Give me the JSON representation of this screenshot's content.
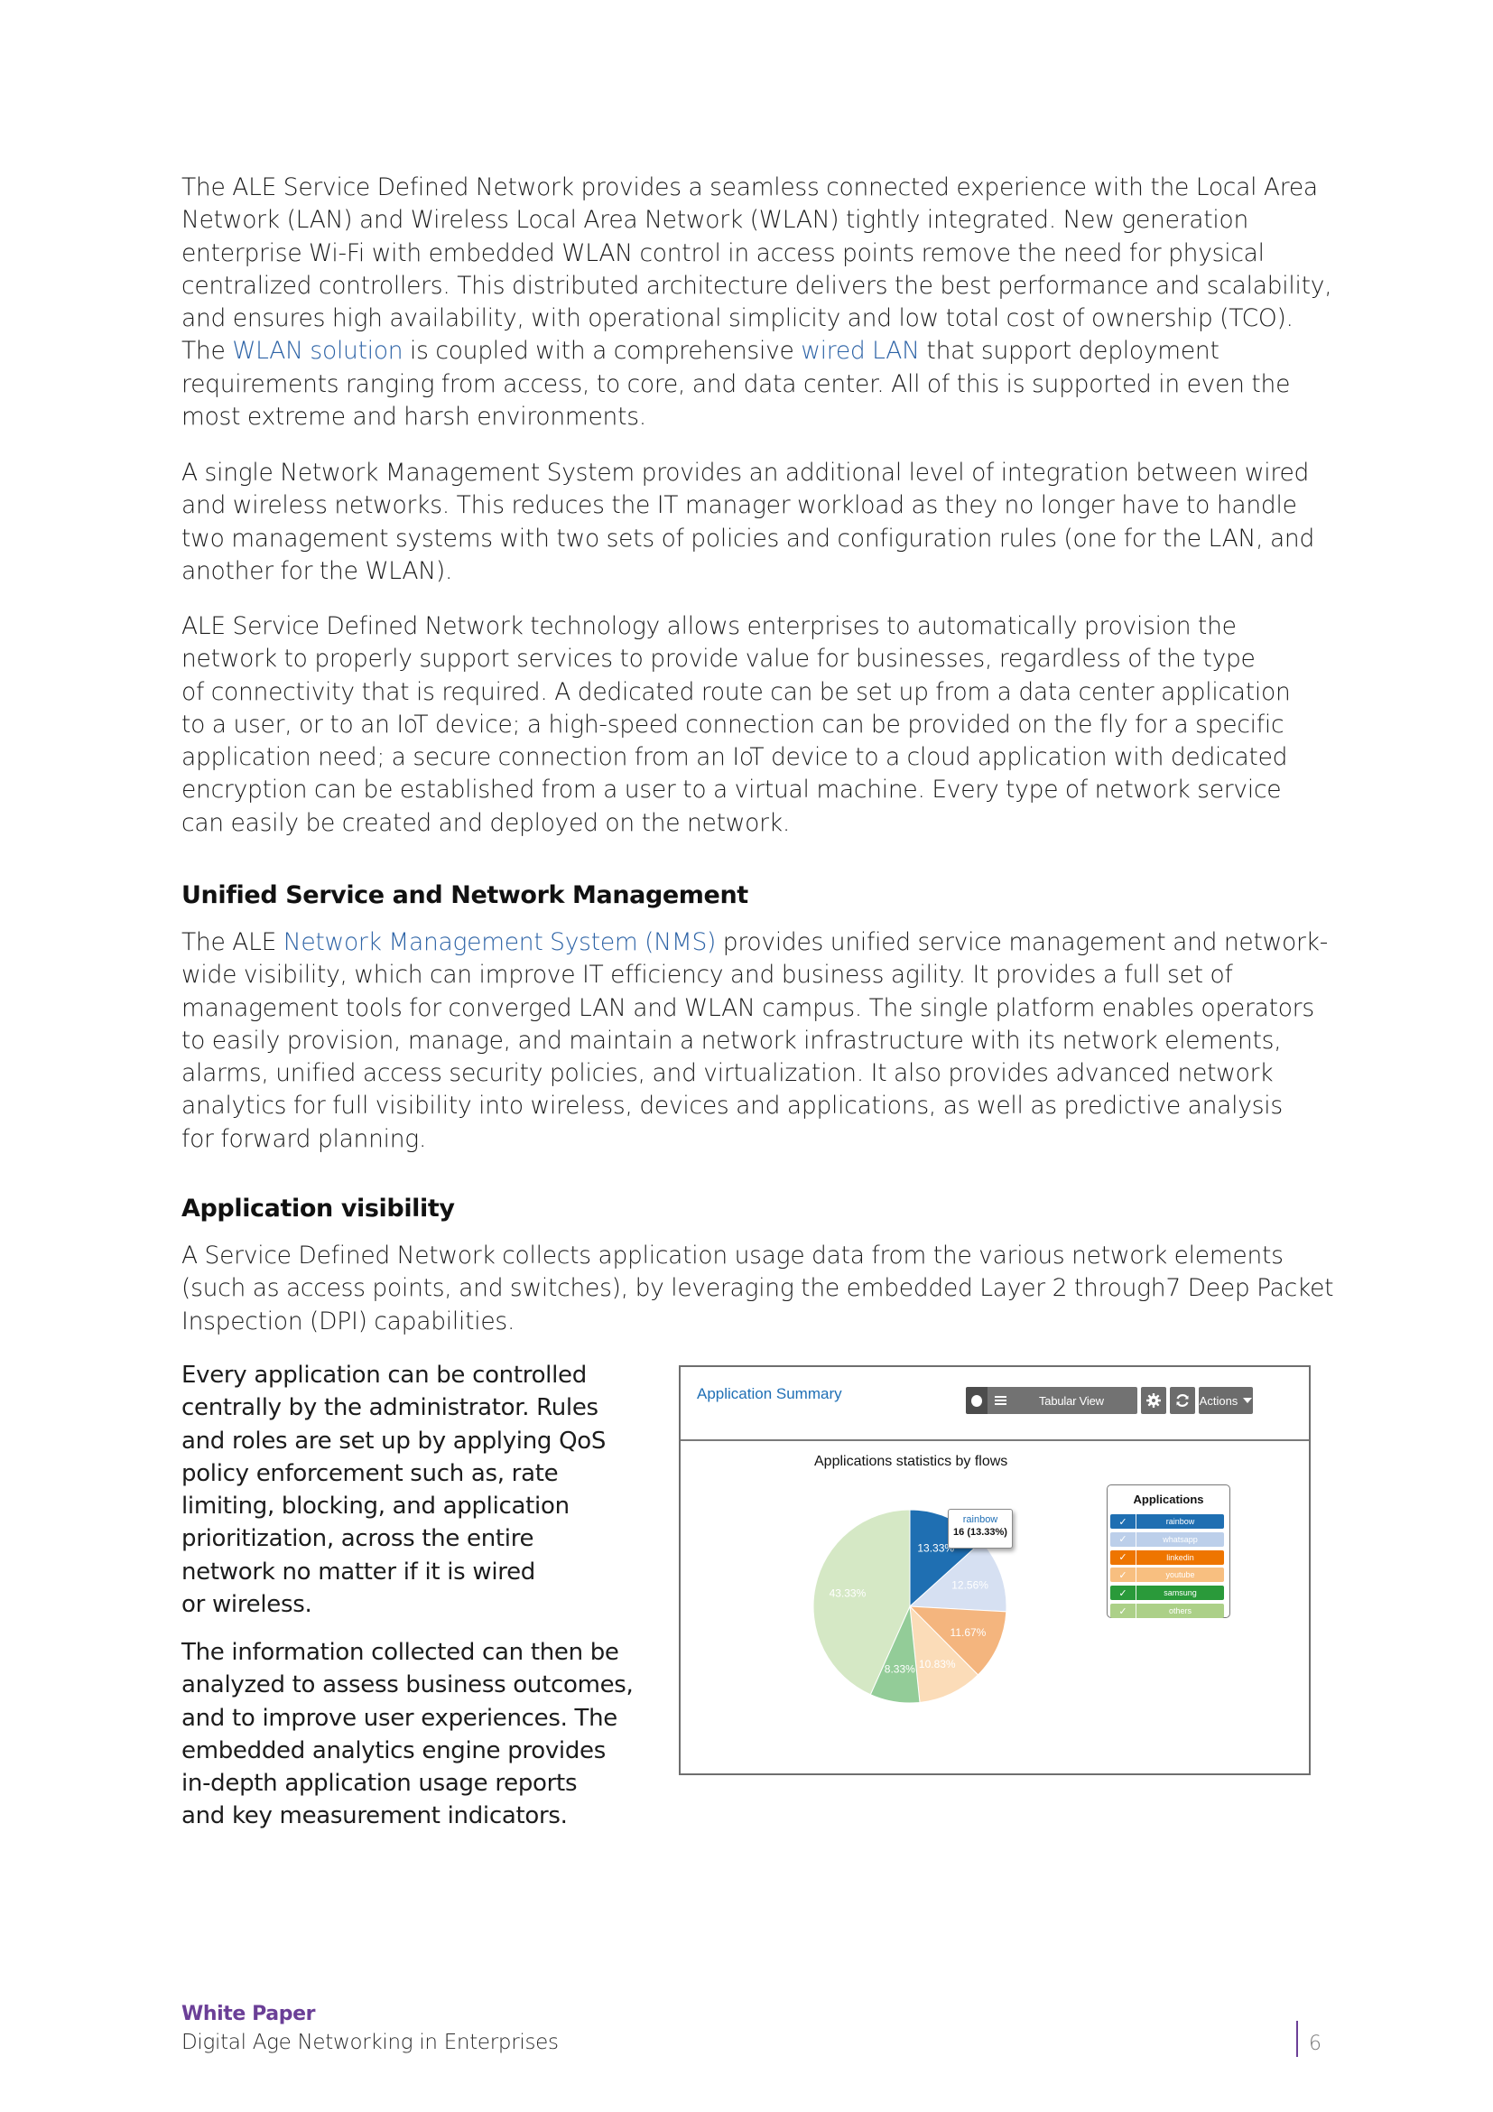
{
  "body": {
    "paragraphs": [
      {
        "lines": [
          "The ALE Service Defined Network provides a seamless connected experience with the Local Area",
          "Network (LAN) and Wireless Local Area Network (WLAN) tightly integrated. New generation",
          "enterprise Wi-Fi with embedded WLAN control in access points remove the need for physical",
          "centralized controllers. This distributed architecture delivers the best performance and scalability,",
          "and ensures high availability, with operational simplicity and low total cost of ownership (TCO).",
          {
            "pre": "The ",
            "link1": "WLAN solution",
            "mid": " is coupled with a comprehensive ",
            "link2": "wired LAN",
            "post": " that support deployment"
          },
          "requirements ranging from access, to core, and data center. All of this is supported in even the",
          "most extreme and harsh environments."
        ]
      },
      {
        "lines": [
          "A single Network Management System provides an additional level of integration between wired",
          "and wireless networks. This reduces the IT manager workload as they no longer have to handle",
          "two management systems with two sets of policies and configuration rules (one for the LAN, and",
          "another for the WLAN)."
        ]
      },
      {
        "lines": [
          "ALE Service Defined Network technology allows enterprises to automatically provision the",
          "network to properly support services to provide value for businesses, regardless of the type",
          "of connectivity that is required. A dedicated route can be set up from a data center application",
          "to a user, or to an IoT device; a high-speed connection can be provided on the fly for a specific",
          "application need; a secure connection from an IoT device to a cloud application with dedicated",
          "encryption can be established from a user to a virtual machine. Every type of network service",
          "can easily be created and deployed on the network."
        ]
      }
    ],
    "section1": {
      "heading": "Unified Service and Network Management",
      "first_line": {
        "pre": "The ALE ",
        "link": "Network Management System (NMS)",
        "post": " provides unified service management and network-"
      },
      "lines": [
        "wide visibility, which can improve IT efficiency and business agility. It provides a full set of",
        "management tools for converged LAN and WLAN campus. The single platform enables operators",
        "to easily provision, manage, and maintain a network infrastructure with its network elements,",
        "alarms, unified access security policies, and virtualization. It also provides advanced network",
        "analytics for full visibility into wireless, devices and applications, as well as predictive analysis",
        "for forward planning."
      ]
    },
    "section2": {
      "heading": "Application visibility",
      "intro_lines": [
        "A Service Defined Network collects application usage data from the various network elements",
        "(such as access points, and switches), by leveraging the embedded Layer 2 through7 Deep Packet",
        "Inspection (DPI) capabilities."
      ],
      "col_para1": [
        "Every application can be controlled",
        "centrally by the administrator. Rules",
        "and roles are set up by applying QoS",
        "policy enforcement such as, rate",
        "limiting, blocking, and application",
        "prioritization, across the entire",
        "network no matter if it is wired",
        "or wireless."
      ],
      "col_para2": [
        "The information collected can then be",
        "analyzed to assess business outcomes,",
        "and to improve user experiences. The",
        "embedded analytics engine provides",
        "in-depth application usage reports",
        "and key measurement indicators."
      ]
    }
  },
  "screenshot": {
    "title": "Application Summary",
    "toolbar": {
      "chart_view_icon": "pie-chart-icon",
      "list_icon": "list-icon",
      "tabular_view_label": "Tabular View",
      "settings_icon": "gear-icon",
      "refresh_icon": "refresh-icon",
      "actions_label": "Actions"
    },
    "tooltip": {
      "name": "rainbow",
      "value": "16 (13.33%)"
    },
    "legend_title": "Applications",
    "legend": [
      {
        "label": "rainbow",
        "color": "#1f6fb2",
        "checked": true
      },
      {
        "label": "whatsapp",
        "color": "#bccfea",
        "checked": true
      },
      {
        "label": "linkedin",
        "color": "#ee7500",
        "checked": true
      },
      {
        "label": "youtube",
        "color": "#f8bf80",
        "checked": true
      },
      {
        "label": "samsung",
        "color": "#2a9a3a",
        "checked": true
      },
      {
        "label": "others",
        "color": "#acd088",
        "checked": true
      }
    ],
    "check_glyph": "✓"
  },
  "chart_data": {
    "type": "pie",
    "title": "Applications statistics by flows",
    "slices": [
      {
        "label": "rainbow",
        "value": 13.33,
        "display": "13.33%",
        "color": "#1f6fb2"
      },
      {
        "label": "whatsapp",
        "value": 12.56,
        "display": "12.56%",
        "color": "#d6e0f2"
      },
      {
        "label": "linkedin",
        "value": 11.67,
        "display": "11.67%",
        "color": "#f4b57e"
      },
      {
        "label": "youtube",
        "value": 10.83,
        "display": "10.83%",
        "color": "#fbdcb8"
      },
      {
        "label": "samsung",
        "value": 8.33,
        "display": "8.33%",
        "color": "#93cc98"
      },
      {
        "label": "others",
        "value": 43.33,
        "display": "43.33%",
        "color": "#d5e8c5"
      }
    ],
    "tooltip_slice": "rainbow",
    "tooltip_count": 16,
    "legend_placement": "right"
  },
  "footer": {
    "title": "White Paper",
    "subtitle": "Digital Age Networking in Enterprises",
    "page_number": "6"
  }
}
